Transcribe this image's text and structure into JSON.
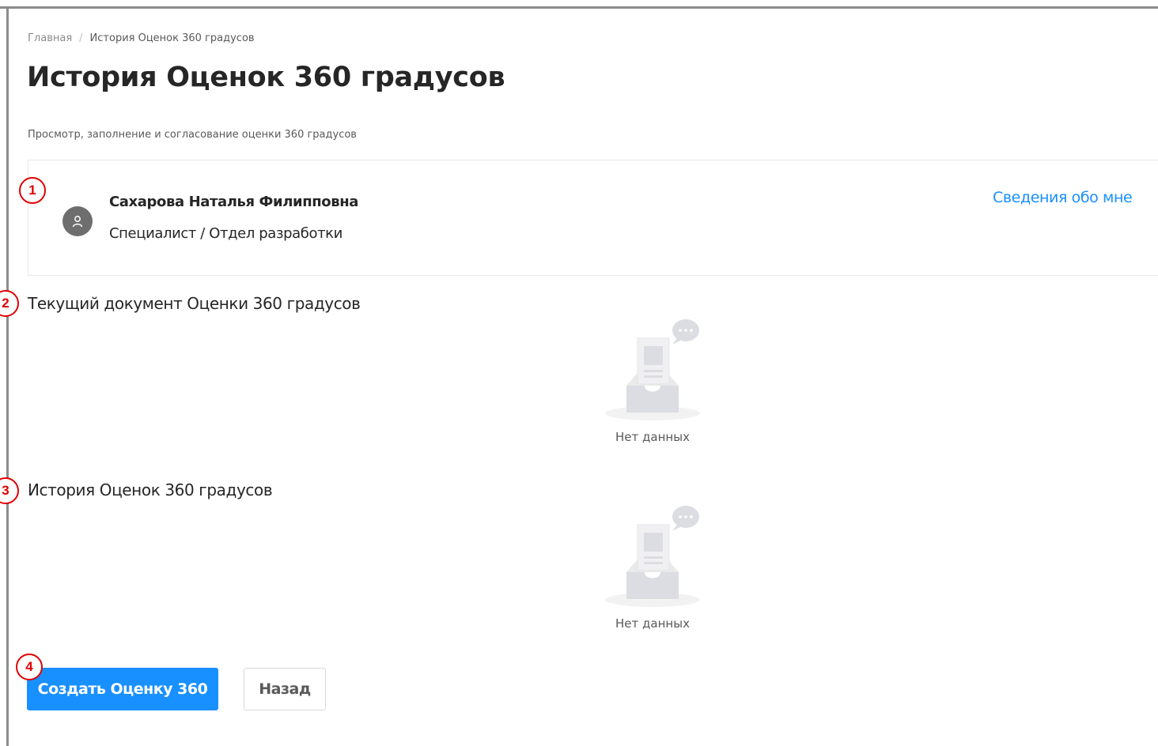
{
  "breadcrumb": {
    "home": "Главная",
    "separator": "/",
    "current": "История Оценок 360 градусов"
  },
  "page": {
    "title": "История Оценок 360 градусов",
    "subtitle": "Просмотр, заполнение и согласование оценки 360 градусов"
  },
  "profile": {
    "name": "Сахарова Наталья Филипповна",
    "role": "Специалист / Отдел разработки",
    "about_link": "Сведения обо мне",
    "avatar_icon": "user-icon"
  },
  "sections": {
    "current_document": {
      "title": "Текущий документ Оценки 360 градусов",
      "empty_text": "Нет данных"
    },
    "history": {
      "title": "История Оценок 360 градусов",
      "empty_text": "Нет данных"
    }
  },
  "actions": {
    "create_label": "Создать Оценку 360",
    "back_label": "Назад"
  },
  "callouts": [
    "1",
    "2",
    "3",
    "4"
  ],
  "colors": {
    "accent": "#1890ff",
    "callout": "#e00000"
  }
}
